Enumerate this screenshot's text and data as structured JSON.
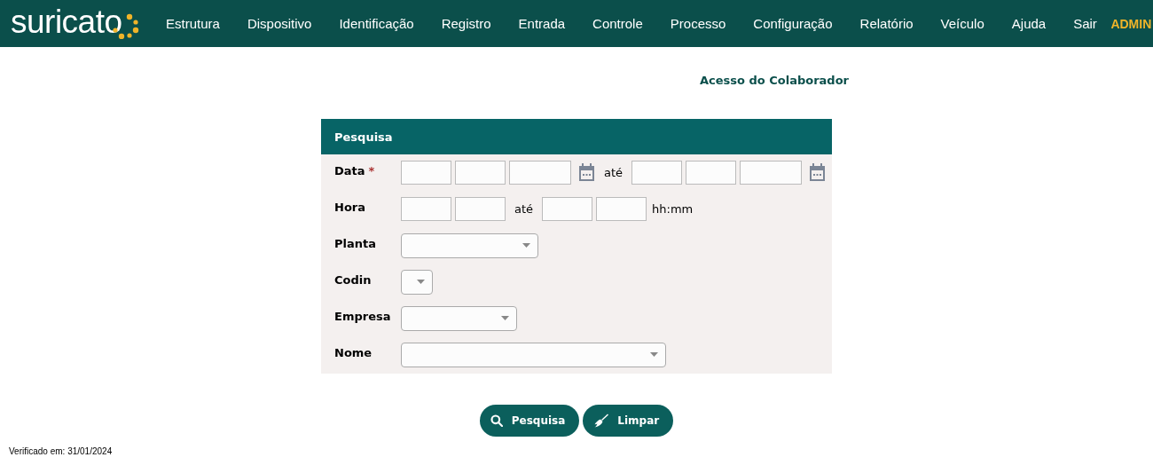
{
  "header": {
    "logo": "suricato",
    "nav": [
      "Estrutura",
      "Dispositivo",
      "Identificação",
      "Registro",
      "Entrada",
      "Controle",
      "Processo",
      "Configuração",
      "Relatório",
      "Veículo",
      "Ajuda",
      "Sair"
    ],
    "user": "ADMIN"
  },
  "page_title": "Acesso do Colaborador",
  "panel": {
    "title": "Pesquisa",
    "rows": [
      {
        "label": "Data",
        "required_mark": "*",
        "kind": "date_range",
        "separator": "até"
      },
      {
        "label": "Hora",
        "kind": "time_range",
        "separator": "até",
        "hint": "hh:mm"
      },
      {
        "label": "Planta",
        "kind": "select"
      },
      {
        "label": "Codin",
        "kind": "select"
      },
      {
        "label": "Empresa",
        "kind": "select"
      },
      {
        "label": "Nome",
        "kind": "select"
      }
    ]
  },
  "buttons": [
    {
      "label": "Pesquisa",
      "kind": "search"
    },
    {
      "label": "Limpar",
      "kind": "clear"
    }
  ],
  "footer": "Verificado em: 31/01/2024"
}
